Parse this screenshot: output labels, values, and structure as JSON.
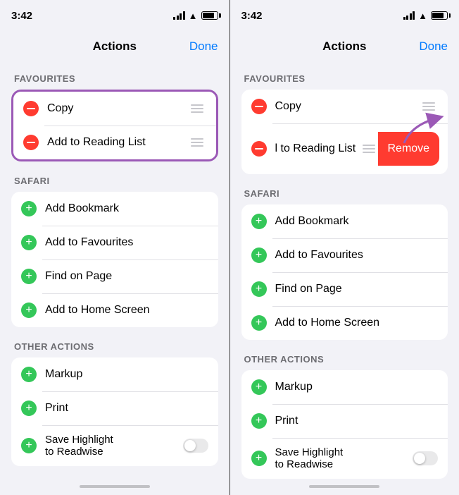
{
  "panels": [
    {
      "id": "left",
      "statusBar": {
        "time": "3:42"
      },
      "navBar": {
        "title": "Actions",
        "doneLabel": "Done"
      },
      "sections": [
        {
          "id": "favourites",
          "label": "Favourites",
          "items": [
            {
              "id": "copy",
              "type": "minus",
              "label": "Copy",
              "hasDrag": true
            },
            {
              "id": "add-reading",
              "type": "minus",
              "label": "Add to Reading List",
              "hasDrag": true
            }
          ],
          "hasOutline": true
        },
        {
          "id": "safari",
          "label": "Safari",
          "items": [
            {
              "id": "add-bookmark",
              "type": "plus",
              "label": "Add Bookmark",
              "hasDrag": false
            },
            {
              "id": "add-favourites",
              "type": "plus",
              "label": "Add to Favourites",
              "hasDrag": false
            },
            {
              "id": "find-page",
              "type": "plus",
              "label": "Find on Page",
              "hasDrag": false
            },
            {
              "id": "add-home",
              "type": "plus",
              "label": "Add to Home Screen",
              "hasDrag": false
            }
          ]
        },
        {
          "id": "other-actions",
          "label": "Other Actions",
          "items": [
            {
              "id": "markup",
              "type": "plus",
              "label": "Markup",
              "hasDrag": false
            },
            {
              "id": "print",
              "type": "plus",
              "label": "Print",
              "hasDrag": false
            },
            {
              "id": "save-highlight",
              "type": "plus",
              "label": "Save Highlight\nto Readwise",
              "hasToggle": true,
              "hasDrag": false
            }
          ]
        }
      ]
    },
    {
      "id": "right",
      "statusBar": {
        "time": "3:42"
      },
      "navBar": {
        "title": "Actions",
        "doneLabel": "Done"
      },
      "sections": [
        {
          "id": "favourites",
          "label": "Favourites",
          "items": [
            {
              "id": "copy",
              "type": "minus",
              "label": "Copy",
              "hasDrag": true
            },
            {
              "id": "add-reading",
              "type": "minus",
              "label": "l to Reading List",
              "hasDrag": true,
              "hasRemove": true
            }
          ]
        },
        {
          "id": "safari",
          "label": "Safari",
          "items": [
            {
              "id": "add-bookmark",
              "type": "plus",
              "label": "Add Bookmark",
              "hasDrag": false
            },
            {
              "id": "add-favourites",
              "type": "plus",
              "label": "Add to Favourites",
              "hasDrag": false
            },
            {
              "id": "find-page",
              "type": "plus",
              "label": "Find on Page",
              "hasDrag": false
            },
            {
              "id": "add-home",
              "type": "plus",
              "label": "Add to Home Screen",
              "hasDrag": false
            }
          ]
        },
        {
          "id": "other-actions",
          "label": "Other Actions",
          "items": [
            {
              "id": "markup",
              "type": "plus",
              "label": "Markup",
              "hasDrag": false
            },
            {
              "id": "print",
              "type": "plus",
              "label": "Print",
              "hasDrag": false
            },
            {
              "id": "save-highlight",
              "type": "plus",
              "label": "Save Highlight\nto Readwise",
              "hasToggle": true,
              "hasDrag": false
            }
          ]
        }
      ],
      "hasArrow": true,
      "removeLabel": "Remove"
    }
  ]
}
